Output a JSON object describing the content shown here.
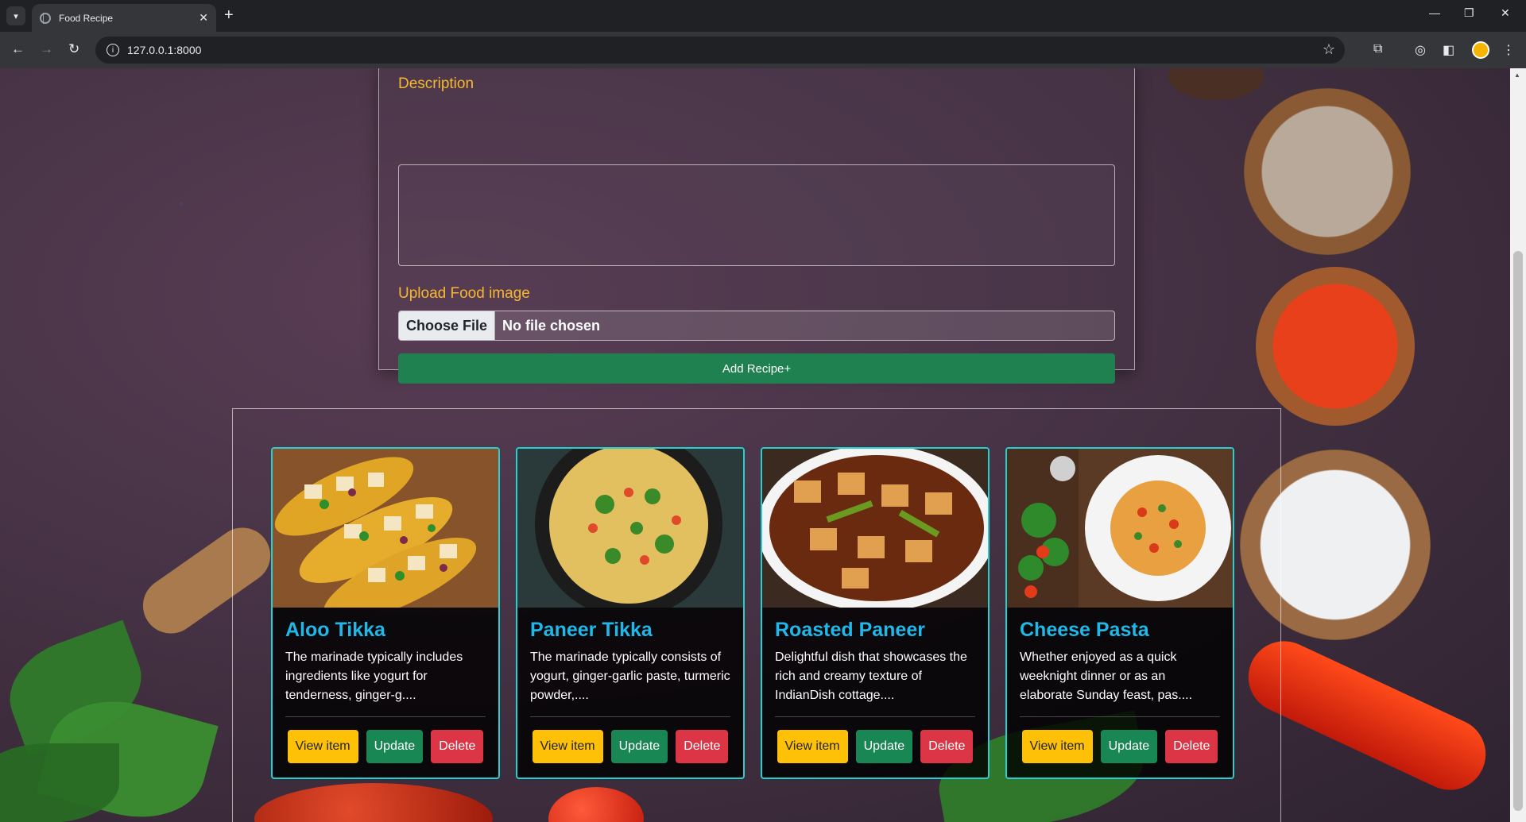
{
  "browser": {
    "tab_title": "Food Recipe",
    "tab_close": "✕",
    "new_tab": "+",
    "url": "127.0.0.1:8000"
  },
  "form": {
    "description_label": "Description",
    "description_value": "",
    "upload_label": "Upload Food image",
    "choose_file_label": "Choose File",
    "file_status": "No file chosen",
    "submit_label": "Add Recipe+"
  },
  "recipes": [
    {
      "title": "Aloo Tikka",
      "text": "The marinade typically includes ingredients like yogurt for tenderness, ginger-g....",
      "view": "View item",
      "update": "Update",
      "delete": "Delete"
    },
    {
      "title": "Paneer Tikka",
      "text": "The marinade typically consists of yogurt, ginger-garlic paste, turmeric powder,....",
      "view": "View item",
      "update": "Update",
      "delete": "Delete"
    },
    {
      "title": "Roasted Paneer",
      "text": "Delightful dish that showcases the rich and creamy texture of IndianDish cottage....",
      "view": "View item",
      "update": "Update",
      "delete": "Delete"
    },
    {
      "title": "Cheese Pasta",
      "text": "Whether enjoyed as a quick weeknight dinner or as an elaborate Sunday feast, pas....",
      "view": "View item",
      "update": "Update",
      "delete": "Delete"
    }
  ],
  "colors": {
    "label": "#f6b82e",
    "card_title": "#1fb8e8",
    "card_border": "#25d0d0",
    "add_button": "#1f8050",
    "view_button": "#ffc107",
    "update_button": "#198754",
    "delete_button": "#dc3545"
  },
  "icons": [
    "tab-search-icon",
    "globe-icon",
    "back-icon",
    "forward-icon",
    "reload-icon",
    "site-info-icon",
    "bookmark-star-icon",
    "extensions-icon",
    "sidebar-icon",
    "profile-avatar-icon",
    "menu-icon"
  ]
}
